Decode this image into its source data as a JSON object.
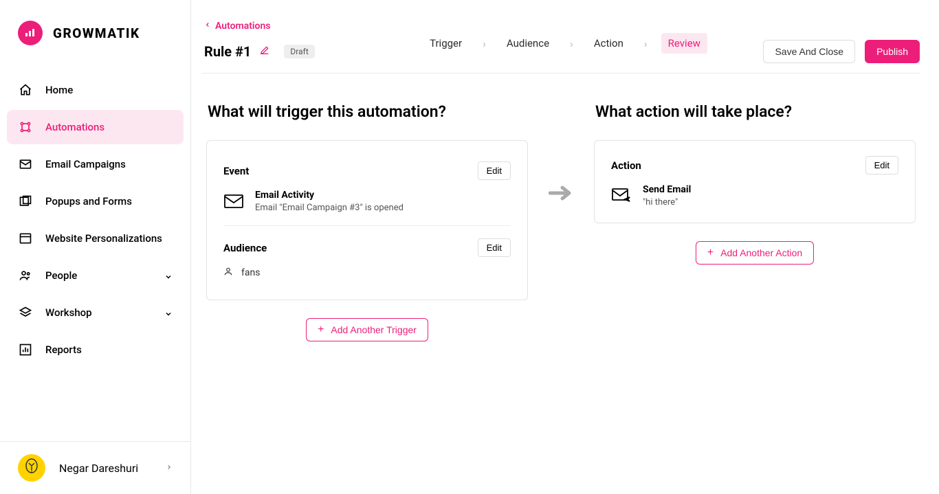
{
  "brand": "GROWMATIK",
  "sidebar": {
    "items": [
      {
        "label": "Home"
      },
      {
        "label": "Automations"
      },
      {
        "label": "Email Campaigns"
      },
      {
        "label": "Popups and Forms"
      },
      {
        "label": "Website Personalizations"
      },
      {
        "label": "People"
      },
      {
        "label": "Workshop"
      },
      {
        "label": "Reports"
      }
    ]
  },
  "user": {
    "name": "Negar Dareshuri"
  },
  "breadcrumb": {
    "back": "Automations"
  },
  "rule": {
    "title": "Rule #1",
    "status": "Draft"
  },
  "steps": {
    "trigger": "Trigger",
    "audience": "Audience",
    "action": "Action",
    "review": "Review"
  },
  "actions": {
    "save": "Save And Close",
    "publish": "Publish"
  },
  "trigger": {
    "heading": "What will trigger this automation?",
    "event_label": "Event",
    "edit": "Edit",
    "event_title": "Email Activity",
    "event_desc": "Email \"Email Campaign #3\" is opened",
    "audience_label": "Audience",
    "audience_value": "fans",
    "add": "Add Another Trigger"
  },
  "action_col": {
    "heading": "What action will take place?",
    "action_label": "Action",
    "edit": "Edit",
    "action_title": "Send Email",
    "action_desc": "\"hi there\"",
    "add": "Add Another Action"
  }
}
